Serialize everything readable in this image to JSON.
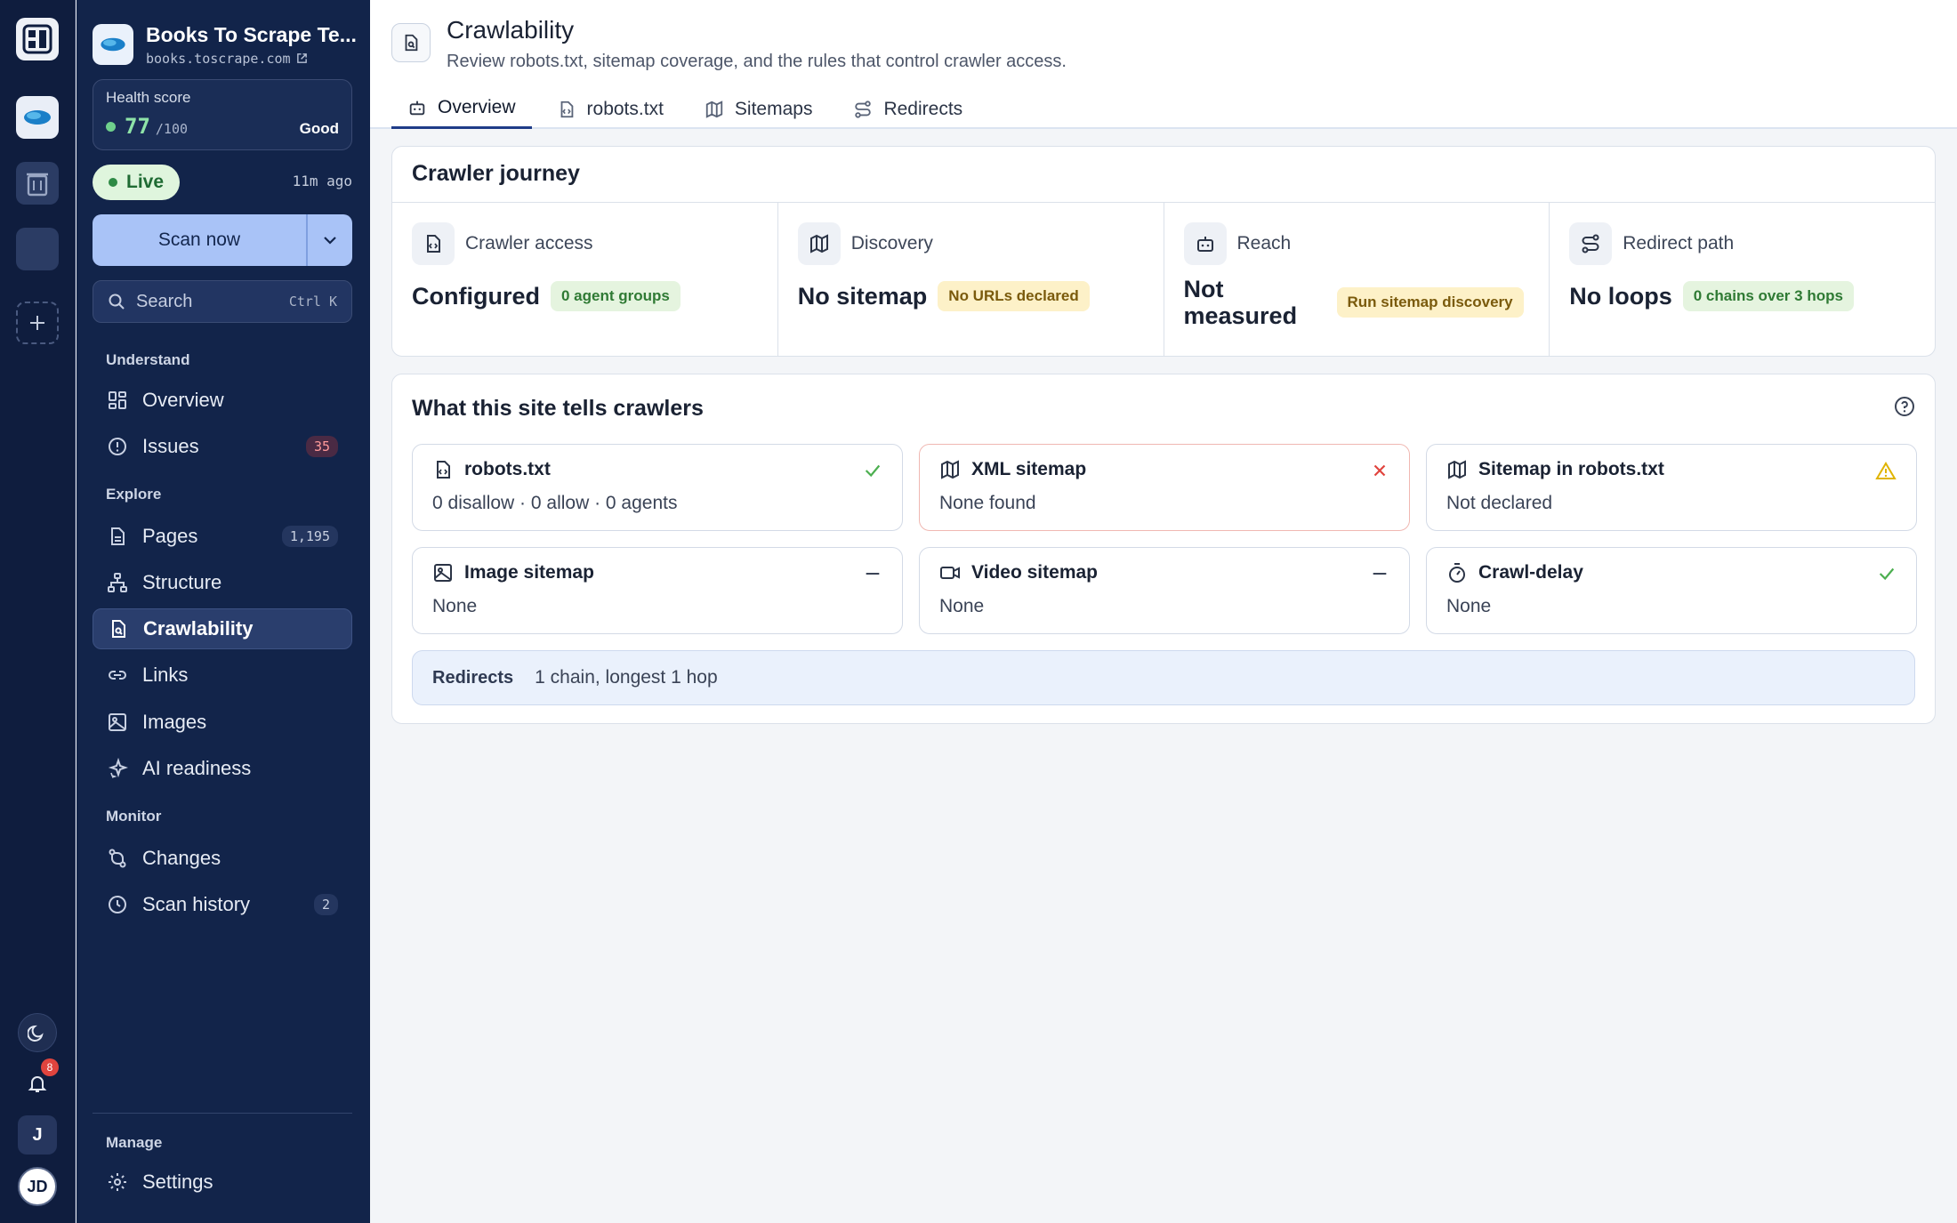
{
  "rail": {
    "workspace_initial": "J",
    "avatar_initials": "JD",
    "notifications_count": "8"
  },
  "site": {
    "name": "Books To Scrape Te...",
    "url": "books.toscrape.com"
  },
  "health": {
    "label": "Health score",
    "value": "77",
    "max": "/100",
    "state": "Good"
  },
  "status": {
    "live_label": "Live",
    "last_scan": "11m ago"
  },
  "scan": {
    "label": "Scan now"
  },
  "search": {
    "placeholder": "Search",
    "shortcut": "Ctrl K"
  },
  "sections": {
    "understand": "Understand",
    "explore": "Explore",
    "monitor": "Monitor",
    "manage": "Manage"
  },
  "nav": {
    "overview": {
      "label": "Overview"
    },
    "issues": {
      "label": "Issues",
      "count": "35"
    },
    "pages": {
      "label": "Pages",
      "count": "1,195"
    },
    "structure": {
      "label": "Structure"
    },
    "crawlability": {
      "label": "Crawlability"
    },
    "links": {
      "label": "Links"
    },
    "images": {
      "label": "Images"
    },
    "ai": {
      "label": "AI readiness"
    },
    "changes": {
      "label": "Changes"
    },
    "history": {
      "label": "Scan history",
      "count": "2"
    },
    "settings": {
      "label": "Settings"
    }
  },
  "page": {
    "title": "Crawlability",
    "subtitle": "Review robots.txt, sitemap coverage, and the rules that control crawler access."
  },
  "tabs": [
    {
      "label": "Overview"
    },
    {
      "label": "robots.txt"
    },
    {
      "label": "Sitemaps"
    },
    {
      "label": "Redirects"
    }
  ],
  "journey": {
    "title": "Crawler journey",
    "access": {
      "label": "Crawler access",
      "value": "Configured",
      "badge": "0 agent groups"
    },
    "discovery": {
      "label": "Discovery",
      "value": "No sitemap",
      "badge": "No URLs declared"
    },
    "reach": {
      "label": "Reach",
      "value": "Not measured",
      "badge": "Run sitemap discovery"
    },
    "redirect": {
      "label": "Redirect path",
      "value": "No loops",
      "badge": "0 chains over 3 hops"
    }
  },
  "tells": {
    "title": "What this site tells crawlers",
    "items": {
      "robots": {
        "name": "robots.txt",
        "desc": "0 disallow · 0 allow · 0 agents"
      },
      "xml": {
        "name": "XML sitemap",
        "desc": "None found"
      },
      "sitemap_robots": {
        "name": "Sitemap in robots.txt",
        "desc": "Not declared"
      },
      "image": {
        "name": "Image sitemap",
        "desc": "None"
      },
      "video": {
        "name": "Video sitemap",
        "desc": "None"
      },
      "delay": {
        "name": "Crawl-delay",
        "desc": "None"
      }
    },
    "redirects": {
      "label": "Redirects",
      "value": "1 chain, longest 1 hop"
    }
  },
  "colors": {
    "sidebar": "#12244a",
    "rail": "#0f1d3e",
    "accent": "#a9c3f7",
    "ok": "#4caf50",
    "error": "#e0443e",
    "warn": "#e0b400"
  }
}
